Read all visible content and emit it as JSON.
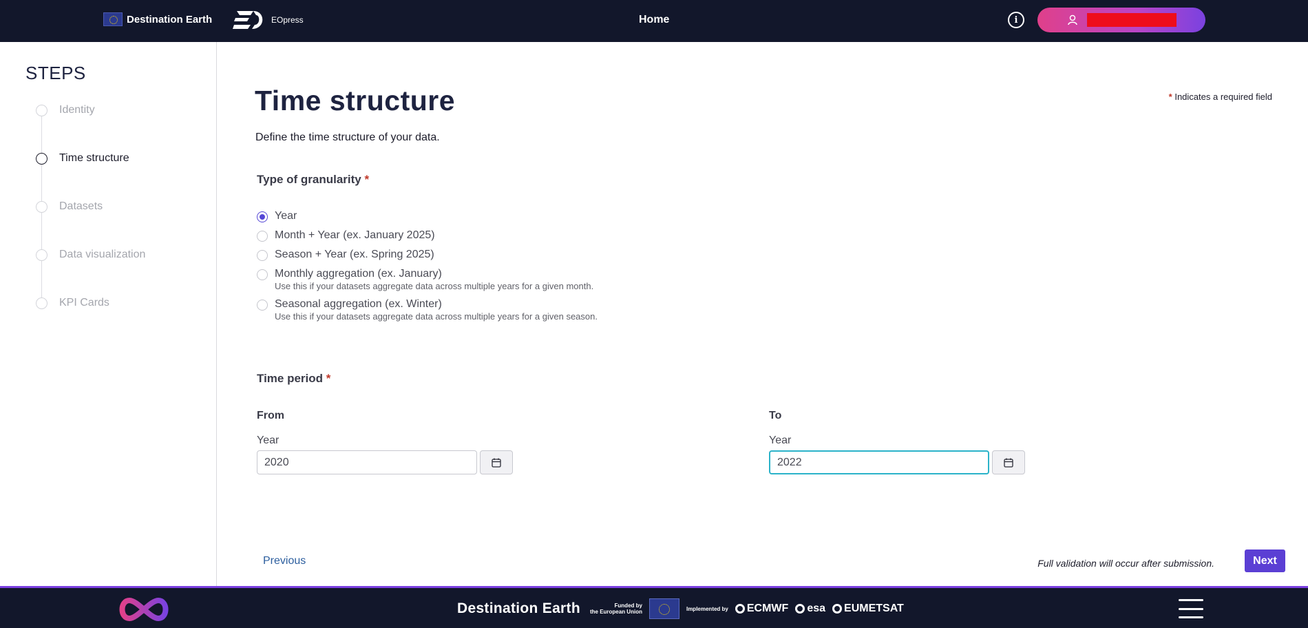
{
  "header": {
    "brand_destination_earth": "Destination Earth",
    "brand_eopress": "EOpress",
    "nav_home": "Home",
    "info_icon": "info-icon",
    "user_icon": "user-icon"
  },
  "sidebar": {
    "title": "STEPS",
    "steps": [
      {
        "label": "Identity",
        "state": "inactive"
      },
      {
        "label": "Time structure",
        "state": "active"
      },
      {
        "label": "Datasets",
        "state": "inactive"
      },
      {
        "label": "Data visualization",
        "state": "inactive"
      },
      {
        "label": "KPI Cards",
        "state": "inactive"
      }
    ]
  },
  "main": {
    "title": "Time structure",
    "required_star": "*",
    "required_note": "Indicates a required field",
    "subtitle": "Define the time structure of your data.",
    "granularity": {
      "label": "Type of granularity",
      "star": "*",
      "options": [
        {
          "label": "Year",
          "hint": "",
          "checked": true
        },
        {
          "label": "Month + Year (ex. January 2025)",
          "hint": "",
          "checked": false
        },
        {
          "label": "Season + Year (ex. Spring 2025)",
          "hint": "",
          "checked": false
        },
        {
          "label": "Monthly aggregation (ex. January)",
          "hint": "Use this if your datasets aggregate data across multiple years for a given month.",
          "checked": false
        },
        {
          "label": "Seasonal aggregation (ex. Winter)",
          "hint": "Use this if your datasets aggregate data across multiple years for a given season.",
          "checked": false
        }
      ]
    },
    "time_period": {
      "label": "Time period",
      "star": "*",
      "from": {
        "heading": "From",
        "field_label": "Year",
        "value": "2020"
      },
      "to": {
        "heading": "To",
        "field_label": "Year",
        "value": "2022"
      }
    },
    "previous_label": "Previous",
    "validation_note": "Full validation will occur after submission.",
    "next_label": "Next"
  },
  "footer": {
    "destination_earth": "Destination Earth",
    "funded_line1": "Funded by",
    "funded_line2": "the European Union",
    "implemented_by": "Implemented by",
    "partners": [
      "ECMWF",
      "esa",
      "EUMETSAT"
    ]
  },
  "colors": {
    "topbar": "#12172b",
    "accent": "#5b3fd4",
    "focus": "#2bb3c9",
    "link": "#2c5e9e",
    "required": "#c0392b"
  }
}
